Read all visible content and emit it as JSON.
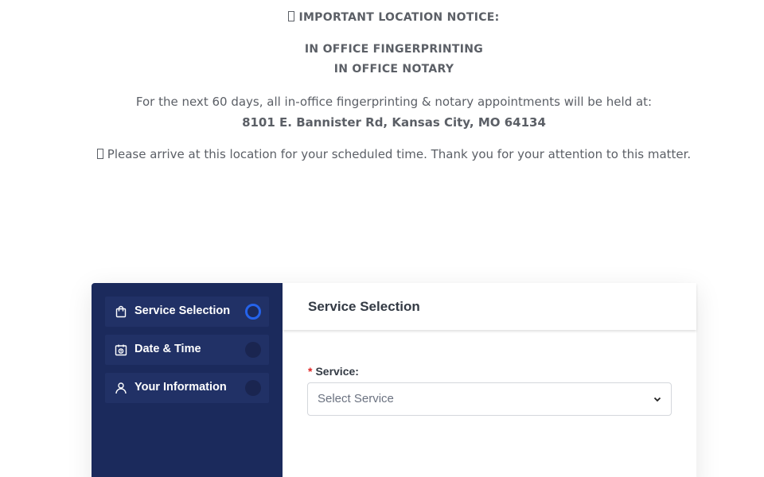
{
  "notice": {
    "title": "IMPORTANT LOCATION NOTICE:",
    "line1": "IN OFFICE FINGERPRINTING",
    "line2": "IN OFFICE NOTARY",
    "body": "For the next 60 days, all in-office fingerprinting & notary appointments will be held at:",
    "address": "8101 E. Bannister Rd, Kansas City, MO 64134",
    "arrive": "Please arrive at this location for your scheduled time. Thank you for your attention to this matter."
  },
  "sidebar": {
    "items": [
      {
        "label": "Service Selection",
        "icon": "shopping-bag-icon",
        "active": true
      },
      {
        "label": "Date & Time",
        "icon": "calendar-clock-icon",
        "active": false
      },
      {
        "label": "Your Information",
        "icon": "user-icon",
        "active": false
      }
    ]
  },
  "main": {
    "title": "Service Selection",
    "service_label": "Service:",
    "required_mark": "*",
    "service_placeholder": "Select Service"
  },
  "colors": {
    "sidebar_bg": "#1b2a5c",
    "accent": "#2563eb",
    "required": "#e02424"
  }
}
